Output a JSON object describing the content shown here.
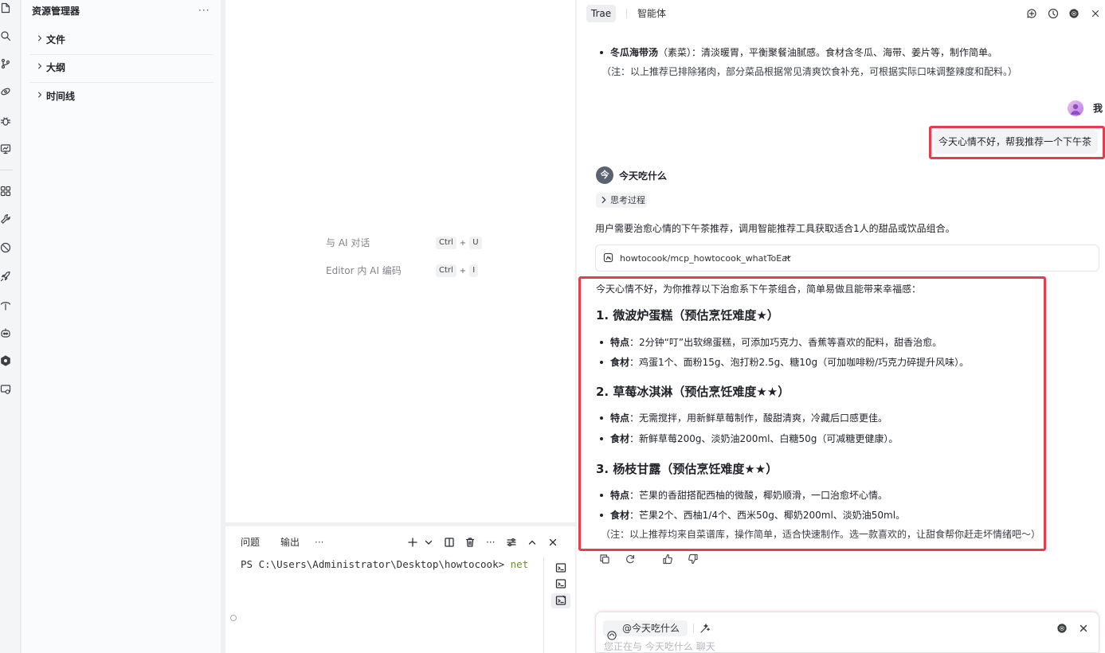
{
  "activity_bar": {
    "icons": [
      "files-icon",
      "search-icon",
      "source-control-icon",
      "eye-icon",
      "debug-icon",
      "remote-explorer-icon",
      "extensions-icon",
      "wrench-icon",
      "compass-icon",
      "rocket-icon",
      "deploy-icon",
      "robot-icon",
      "hexagon-icon",
      "remote-monitor-icon"
    ]
  },
  "sidebar": {
    "title": "资源管理器",
    "more": "···",
    "sections": [
      {
        "label": "文件"
      },
      {
        "label": "大纲"
      },
      {
        "label": "时间线"
      }
    ]
  },
  "editor": {
    "shortcuts": [
      {
        "label": "与 AI 对话",
        "mod": "Ctrl",
        "plus": "+",
        "key": "U"
      },
      {
        "label": "Editor 内 AI 编码",
        "mod": "Ctrl",
        "plus": "+",
        "key": "I"
      }
    ]
  },
  "panel": {
    "tabs": [
      {
        "label": "问题"
      },
      {
        "label": "输出"
      }
    ],
    "more": "···",
    "toolbar_more": "···",
    "terminal": {
      "prompt": "PS C:\\Users\\Administrator\\Desktop\\howtocook> ",
      "command": "net"
    }
  },
  "chat": {
    "tabs": [
      {
        "label": "Trae",
        "active": true
      },
      {
        "label": "智能体",
        "active": false
      }
    ],
    "previous": {
      "bullet_bold": "冬瓜海带汤",
      "bullet_text": "（素菜）：清淡暖胃，平衡聚餐油腻感。食材含冬瓜、海带、姜片等，制作简单。",
      "note": "（注：以上推荐已排除猪肉，部分菜品根据常见清爽饮食补充，可根据实际口味调整辣度和配料。）"
    },
    "user": {
      "name": "我",
      "message": "今天心情不好，帮我推荐一个下午茶"
    },
    "agent": {
      "name": "今天吃什么",
      "avatar_char": "今",
      "thinking": "思考过程",
      "summary": "用户需要治愈心情的下午茶推荐，调用智能推荐工具获取适合1人的甜品或饮品组合。",
      "tool_call": "howtocook/mcp_howtocook_whatToEat",
      "intro": "今天心情不好，为你推荐以下治愈系下午茶组合，简单易做且能带来幸福感：",
      "items": [
        {
          "title": "1. 微波炉蛋糕（预估烹饪难度★）",
          "bullets": [
            {
              "label": "特点",
              "text": "：2分钟“叮”出软绵蛋糕，可添加巧克力、香蕉等喜欢的配料，甜香治愈。"
            },
            {
              "label": "食材",
              "text": "：鸡蛋1个、面粉15g、泡打粉2.5g、糖10g（可加咖啡粉/巧克力碎提升风味）。"
            }
          ]
        },
        {
          "title": "2. 草莓冰淇淋（预估烹饪难度★★）",
          "bullets": [
            {
              "label": "特点",
              "text": "：无需搅拌，用新鲜草莓制作，酸甜清爽，冷藏后口感更佳。"
            },
            {
              "label": "食材",
              "text": "：新鲜草莓200g、淡奶油200ml、白糖50g（可减糖更健康）。"
            }
          ]
        },
        {
          "title": "3. 杨枝甘露（预估烹饪难度★★）",
          "bullets": [
            {
              "label": "特点",
              "text": "：芒果的香甜搭配西柚的微酸，椰奶顺滑，一口治愈坏心情。"
            },
            {
              "label": "食材",
              "text": "：芒果2个、西柚1/4个、西米50g、椰奶200ml、淡奶油50ml。"
            }
          ]
        }
      ],
      "note": "（注：以上推荐均来自菜谱库，操作简单，适合快速制作。选一款喜欢的，让甜食帮你赶走坏情绪吧～）"
    },
    "input": {
      "mention": "@今天吃什么",
      "placeholder": "您正在与 今天吃什么 聊天"
    }
  },
  "colors": {
    "highlight": "#e33d4e",
    "agent_avatar": "#5b6270",
    "user_avatar": "#c58be8",
    "panel_bg": "#ffffff",
    "gutter_bg": "#eef0f2"
  }
}
